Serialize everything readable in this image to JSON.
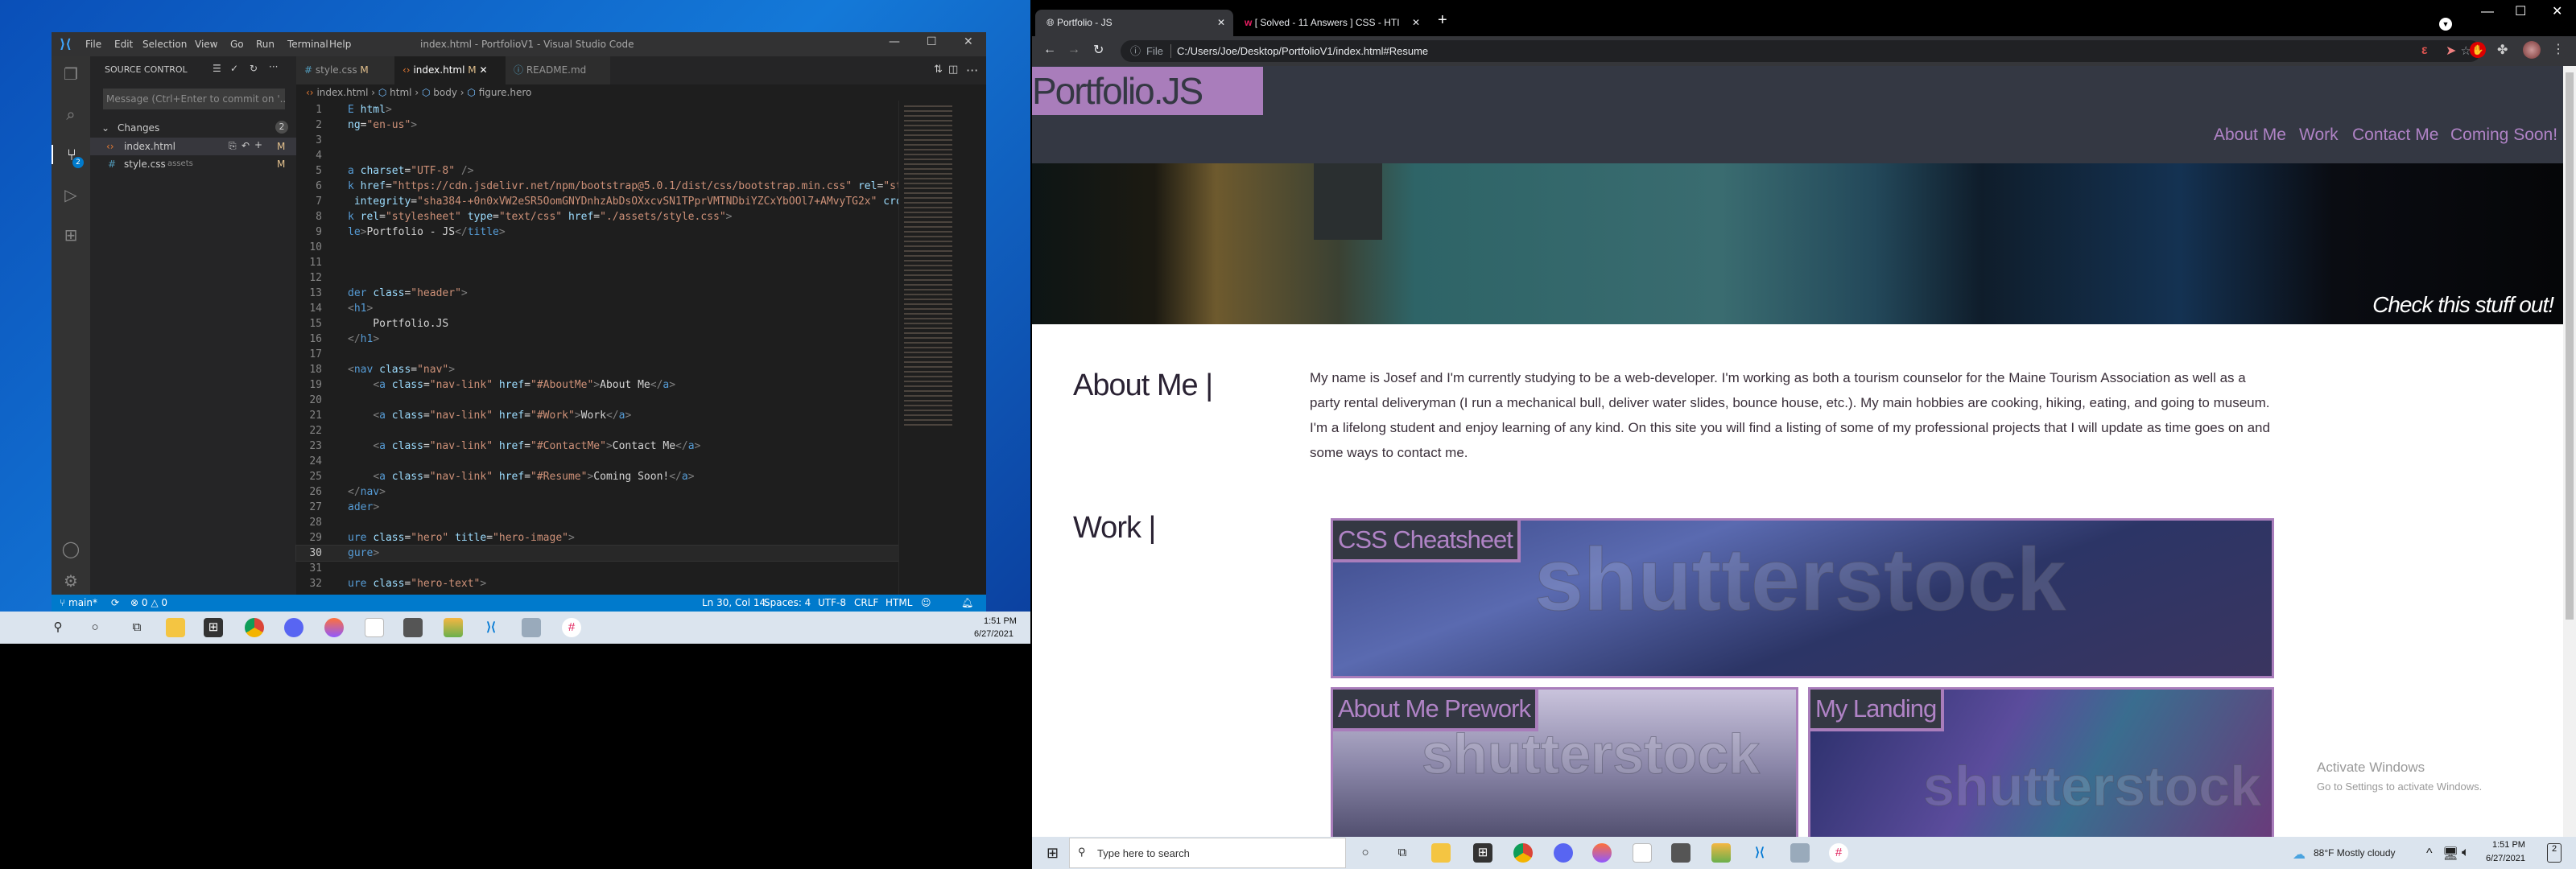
{
  "vscode": {
    "menu": [
      "File",
      "Edit",
      "Selection",
      "View",
      "Go",
      "Run",
      "Terminal",
      "Help"
    ],
    "title": "index.html - PortfolioV1 - Visual Studio Code",
    "sidebar": {
      "header": "SOURCE CONTROL",
      "message_placeholder": "Message (Ctrl+Enter to commit on '...",
      "changes_label": "Changes",
      "changes_count": "2",
      "files": [
        {
          "name": "index.html",
          "path": "",
          "status": "M"
        },
        {
          "name": "style.css",
          "path": "assets",
          "status": "M"
        }
      ]
    },
    "scm_badge": "2",
    "tabs": [
      {
        "label": "style.css",
        "status": "M"
      },
      {
        "label": "index.html",
        "status": "M"
      },
      {
        "label": "README.md",
        "status": ""
      }
    ],
    "breadcrumb": [
      "index.html",
      "html",
      "body",
      "figure.hero"
    ],
    "code": [
      [
        [
          "t",
          "E "
        ],
        [
          "a",
          "html"
        ],
        [
          "p",
          ">"
        ]
      ],
      [
        [
          "a",
          "ng"
        ],
        [
          "x",
          "="
        ],
        [
          "s",
          "\"en-us\""
        ],
        [
          "p",
          ">"
        ]
      ],
      [],
      [],
      [
        [
          "t",
          "a "
        ],
        [
          "a",
          "charset"
        ],
        [
          "x",
          "="
        ],
        [
          "s",
          "\"UTF-8\""
        ],
        [
          "x",
          " "
        ],
        [
          "p",
          "/>"
        ]
      ],
      [
        [
          "t",
          "k "
        ],
        [
          "a",
          "href"
        ],
        [
          "x",
          "="
        ],
        [
          "s",
          "\"https://cdn.jsdelivr.net/npm/bootstrap@5.0.1/dist/css/bootstrap.min.css\""
        ],
        [
          "x",
          " "
        ],
        [
          "a",
          "rel"
        ],
        [
          "x",
          "="
        ],
        [
          "s",
          "\"st"
        ]
      ],
      [
        [
          "x",
          " "
        ],
        [
          "a",
          "integrity"
        ],
        [
          "x",
          "="
        ],
        [
          "s",
          "\"sha384-+0n0xVW2eSR5OomGNYDnhzAbDsOXxcvSN1TPprVMTNDbiYZCxYbOOl7+AMvyTG2x\""
        ],
        [
          "x",
          " "
        ],
        [
          "a",
          "cros"
        ]
      ],
      [
        [
          "t",
          "k "
        ],
        [
          "a",
          "rel"
        ],
        [
          "x",
          "="
        ],
        [
          "s",
          "\"stylesheet\""
        ],
        [
          "x",
          " "
        ],
        [
          "a",
          "type"
        ],
        [
          "x",
          "="
        ],
        [
          "s",
          "\"text/css\""
        ],
        [
          "x",
          " "
        ],
        [
          "a",
          "href"
        ],
        [
          "x",
          "="
        ],
        [
          "s",
          "\"./assets/style.css\""
        ],
        [
          "p",
          ">"
        ]
      ],
      [
        [
          "t",
          "le"
        ],
        [
          "p",
          ">"
        ],
        [
          "x",
          "Portfolio - JS"
        ],
        [
          "p",
          "</"
        ],
        [
          "t",
          "title"
        ],
        [
          "p",
          ">"
        ]
      ],
      [],
      [],
      [],
      [
        [
          "t",
          "der "
        ],
        [
          "a",
          "class"
        ],
        [
          "x",
          "="
        ],
        [
          "s",
          "\"header\""
        ],
        [
          "p",
          ">"
        ]
      ],
      [
        [
          "p",
          "<"
        ],
        [
          "t",
          "h1"
        ],
        [
          "p",
          ">"
        ]
      ],
      [
        [
          "x",
          "    Portfolio.JS"
        ]
      ],
      [
        [
          "p",
          "</"
        ],
        [
          "t",
          "h1"
        ],
        [
          "p",
          ">"
        ]
      ],
      [],
      [
        [
          "p",
          "<"
        ],
        [
          "t",
          "nav "
        ],
        [
          "a",
          "class"
        ],
        [
          "x",
          "="
        ],
        [
          "s",
          "\"nav\""
        ],
        [
          "p",
          ">"
        ]
      ],
      [
        [
          "x",
          "    "
        ],
        [
          "p",
          "<"
        ],
        [
          "t",
          "a "
        ],
        [
          "a",
          "class"
        ],
        [
          "x",
          "="
        ],
        [
          "s",
          "\"nav-link\""
        ],
        [
          "x",
          " "
        ],
        [
          "a",
          "href"
        ],
        [
          "x",
          "="
        ],
        [
          "s",
          "\"#AboutMe\""
        ],
        [
          "p",
          ">"
        ],
        [
          "x",
          "About Me"
        ],
        [
          "p",
          "</"
        ],
        [
          "t",
          "a"
        ],
        [
          "p",
          ">"
        ]
      ],
      [],
      [
        [
          "x",
          "    "
        ],
        [
          "p",
          "<"
        ],
        [
          "t",
          "a "
        ],
        [
          "a",
          "class"
        ],
        [
          "x",
          "="
        ],
        [
          "s",
          "\"nav-link\""
        ],
        [
          "x",
          " "
        ],
        [
          "a",
          "href"
        ],
        [
          "x",
          "="
        ],
        [
          "s",
          "\"#Work\""
        ],
        [
          "p",
          ">"
        ],
        [
          "x",
          "Work"
        ],
        [
          "p",
          "</"
        ],
        [
          "t",
          "a"
        ],
        [
          "p",
          ">"
        ]
      ],
      [],
      [
        [
          "x",
          "    "
        ],
        [
          "p",
          "<"
        ],
        [
          "t",
          "a "
        ],
        [
          "a",
          "class"
        ],
        [
          "x",
          "="
        ],
        [
          "s",
          "\"nav-link\""
        ],
        [
          "x",
          " "
        ],
        [
          "a",
          "href"
        ],
        [
          "x",
          "="
        ],
        [
          "s",
          "\"#ContactMe\""
        ],
        [
          "p",
          ">"
        ],
        [
          "x",
          "Contact Me"
        ],
        [
          "p",
          "</"
        ],
        [
          "t",
          "a"
        ],
        [
          "p",
          ">"
        ]
      ],
      [],
      [
        [
          "x",
          "    "
        ],
        [
          "p",
          "<"
        ],
        [
          "t",
          "a "
        ],
        [
          "a",
          "class"
        ],
        [
          "x",
          "="
        ],
        [
          "s",
          "\"nav-link\""
        ],
        [
          "x",
          " "
        ],
        [
          "a",
          "href"
        ],
        [
          "x",
          "="
        ],
        [
          "s",
          "\"#Resume\""
        ],
        [
          "p",
          ">"
        ],
        [
          "x",
          "Coming Soon!"
        ],
        [
          "p",
          "</"
        ],
        [
          "t",
          "a"
        ],
        [
          "p",
          ">"
        ]
      ],
      [
        [
          "p",
          "</"
        ],
        [
          "t",
          "nav"
        ],
        [
          "p",
          ">"
        ]
      ],
      [
        [
          "t",
          "ader"
        ],
        [
          "p",
          ">"
        ]
      ],
      [],
      [
        [
          "t",
          "ure "
        ],
        [
          "a",
          "class"
        ],
        [
          "x",
          "="
        ],
        [
          "s",
          "\"hero\""
        ],
        [
          "x",
          " "
        ],
        [
          "a",
          "title"
        ],
        [
          "x",
          "="
        ],
        [
          "s",
          "\"hero-image\""
        ],
        [
          "p",
          ">"
        ]
      ],
      [
        [
          "t",
          "gure"
        ],
        [
          "p",
          ">"
        ]
      ],
      [],
      [
        [
          "t",
          "ure "
        ],
        [
          "a",
          "class"
        ],
        [
          "x",
          "="
        ],
        [
          "s",
          "\"hero-text\""
        ],
        [
          "p",
          ">"
        ]
      ]
    ],
    "status": {
      "branch": "main*",
      "errors": "0",
      "warnings": "0",
      "position": "Ln 30, Col 14",
      "spaces": "Spaces: 4",
      "encoding": "UTF-8",
      "eol": "CRLF",
      "language": "HTML"
    }
  },
  "left_taskbar": {
    "time": "1:51 PM",
    "date": "6/27/2021"
  },
  "chrome": {
    "tabs": [
      {
        "label": "Portfolio - JS"
      },
      {
        "label": "[ Solved - 11 Answers ] CSS - HTI"
      }
    ],
    "address_scheme": "File",
    "url": "C:/Users/Joe/Desktop/PortfolioV1/index.html#Resume"
  },
  "site": {
    "logo": "Portfolio.JS",
    "nav": [
      "About Me",
      "Work",
      "Contact Me",
      "Coming Soon!"
    ],
    "hero_text": "Check this stuff out!",
    "about_heading": "About Me |",
    "about_text": "My name is Josef and I'm currently studying to be a web-developer. I'm working as both a tourism counselor for the Maine Tourism Association as well as a party rental deliveryman (I run a mechanical bull, deliver water slides, bounce house, etc.). My main hobbies are cooking, hiking, eating, and going to museum. I'm a lifelong student and enjoy learning of any kind. On this site you will find a listing of some of my professional projects that I will update as time goes on and some ways to contact me.",
    "work_heading": "Work |",
    "projects": [
      {
        "title": "CSS Cheatsheet"
      },
      {
        "title": "About Me Prework"
      },
      {
        "title": "My Landing"
      }
    ],
    "watermark": "shutterstock",
    "accent": "#a97dbb",
    "header_bg": "#343843"
  },
  "windows": {
    "activate_title": "Activate Windows",
    "activate_sub": "Go to Settings to activate Windows."
  },
  "bottom_taskbar": {
    "search_placeholder": "Type here to search",
    "weather": "88°F  Mostly cloudy",
    "time": "1:51 PM",
    "date": "6/27/2021",
    "notifications": "2"
  }
}
